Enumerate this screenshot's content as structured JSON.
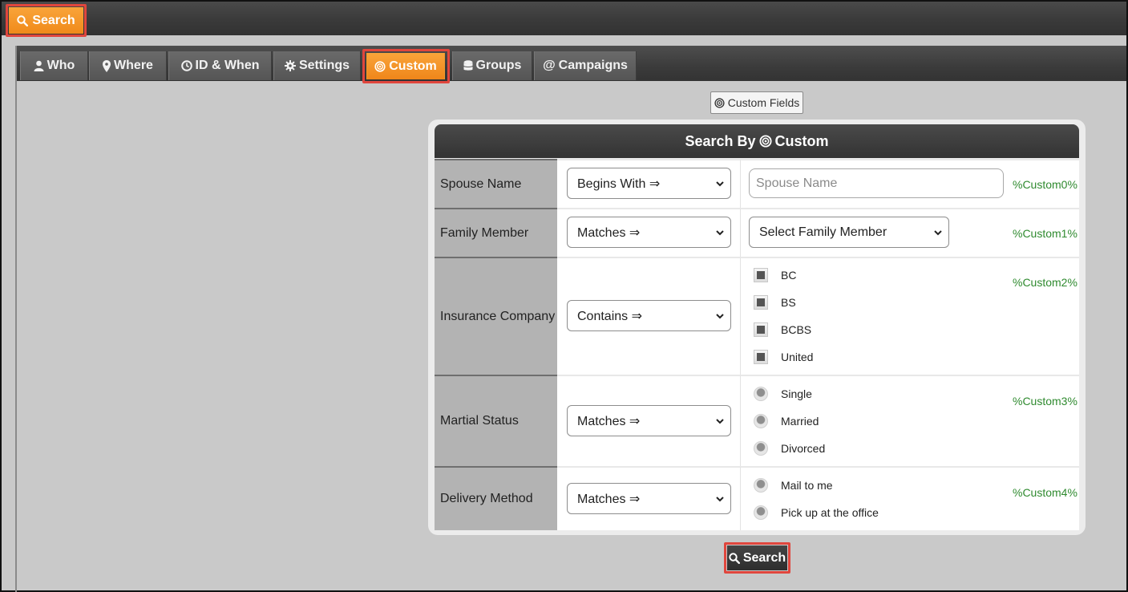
{
  "top_bar": {
    "search_label": "Search"
  },
  "tabs": [
    {
      "label": "Who",
      "icon": "user-icon"
    },
    {
      "label": "Where",
      "icon": "map-pin-icon"
    },
    {
      "label": "ID & When",
      "icon": "clock-icon"
    },
    {
      "label": "Settings",
      "icon": "gear-icon"
    },
    {
      "label": "Custom",
      "icon": "target-icon",
      "active": true
    },
    {
      "label": "Groups",
      "icon": "database-icon"
    },
    {
      "label": "Campaigns",
      "icon": "at-icon"
    }
  ],
  "custom_fields_button": {
    "label": "Custom Fields",
    "icon": "target-icon"
  },
  "panel": {
    "title_prefix": "Search By",
    "title_suffix": "Custom",
    "rows": [
      {
        "label": "Spouse Name",
        "operator": "Begins With ⇒",
        "input_placeholder": "Spouse Name",
        "token": "%Custom0%"
      },
      {
        "label": "Family Member",
        "operator": "Matches ⇒",
        "value_select": "Select Family Member",
        "token": "%Custom1%"
      },
      {
        "label": "Insurance Company",
        "operator": "Contains ⇒",
        "checkboxes": [
          "BC",
          "BS",
          "BCBS",
          "United"
        ],
        "token": "%Custom2%"
      },
      {
        "label": "Martial Status",
        "operator": "Matches ⇒",
        "radios": [
          "Single",
          "Married",
          "Divorced"
        ],
        "token": "%Custom3%"
      },
      {
        "label": "Delivery Method",
        "operator": "Matches ⇒",
        "radios": [
          "Mail to me",
          "Pick up at the office"
        ],
        "token": "%Custom4%"
      }
    ]
  },
  "bottom_search": {
    "label": "Search"
  },
  "colors": {
    "accent_orange": "#f39a2b",
    "highlight_red": "#e0463d",
    "token_green": "#2f8a2f",
    "dark_bar": "#3a3a3a"
  }
}
